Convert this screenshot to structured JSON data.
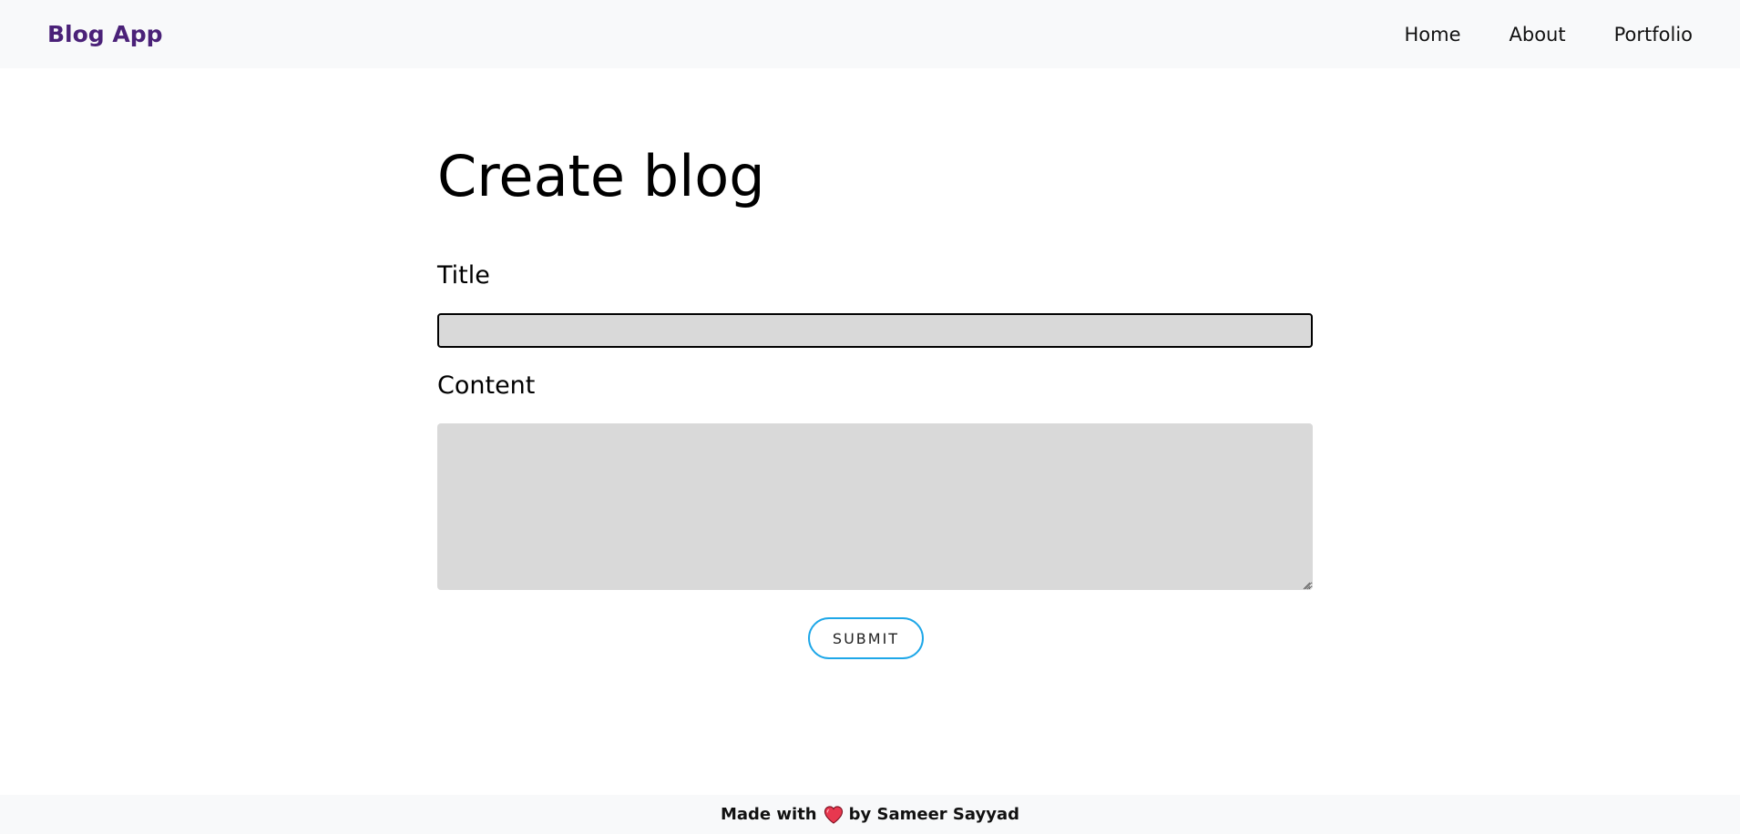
{
  "header": {
    "brand": "Blog App",
    "nav": [
      {
        "label": "Home"
      },
      {
        "label": "About"
      },
      {
        "label": "Portfolio"
      }
    ]
  },
  "main": {
    "heading": "Create blog",
    "title_label": "Title",
    "title_value": "",
    "content_label": "Content",
    "content_value": "",
    "submit_label": "SUBMIT"
  },
  "footer": {
    "prefix": "Made with",
    "suffix": "by Sameer Sayyad",
    "icon": "heart-icon"
  },
  "colors": {
    "brand": "#4a2178",
    "navbar_bg": "#f8f9fa",
    "input_bg": "#d9d9d9",
    "submit_border": "#1ea7e8",
    "heart": "#e8384f"
  }
}
